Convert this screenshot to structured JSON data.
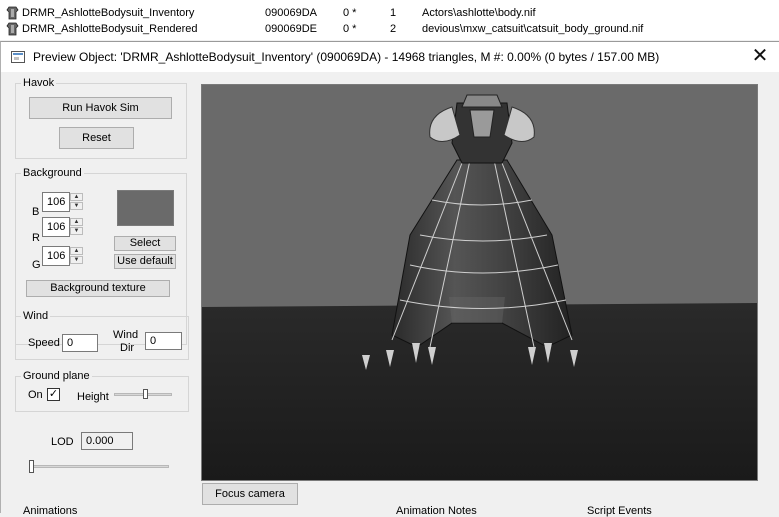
{
  "background_list": {
    "rows": [
      {
        "name": "DRMR_AshlotteBodysuit_Inventory",
        "id": "090069DA",
        "flag": "0 *",
        "count": "1",
        "path": "Actors\\ashlotte\\body.nif"
      },
      {
        "name": "DRMR_AshlotteBodysuit_Rendered",
        "id": "090069DE",
        "flag": "0 *",
        "count": "2",
        "path": "devious\\mxw_catsuit\\catsuit_body_ground.nif"
      }
    ]
  },
  "dialog": {
    "title": "Preview Object: 'DRMR_AshlotteBodysuit_Inventory' (090069DA) - 14968 triangles, M #: 0.00% (0 bytes / 157.00 MB)",
    "close_symbol": "✕"
  },
  "havok": {
    "legend": "Havok",
    "run_label": "Run Havok Sim",
    "reset_label": "Reset"
  },
  "background": {
    "legend": "Background",
    "b_label": "B",
    "b_value": "106",
    "r_label": "R",
    "r_value": "106",
    "g_label": "G",
    "g_value": "106",
    "select_label": "Select",
    "use_default_label": "Use default",
    "texture_label": "Background texture",
    "swatch_color": "#6a6a6a"
  },
  "wind": {
    "legend": "Wind",
    "speed_label": "Speed",
    "speed_value": "0",
    "dir_label_1": "Wind",
    "dir_label_2": "Dir",
    "dir_value": "0"
  },
  "ground_plane": {
    "legend": "Ground plane",
    "on_label": "On",
    "on_checked": true,
    "check_mark": "✓",
    "height_label": "Height",
    "height_level": 0.55
  },
  "lod": {
    "label": "LOD",
    "value": "0.000",
    "level": 0.0
  },
  "focus_camera_label": "Focus camera",
  "bottom_sections": {
    "animations": "Animations",
    "animation_notes": "Animation Notes",
    "script_events": "Script Events"
  }
}
